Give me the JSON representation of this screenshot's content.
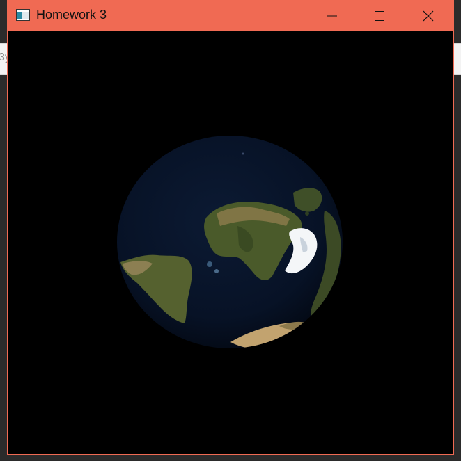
{
  "background_window": {
    "partial_text": "3y"
  },
  "window": {
    "title": "Homework 3",
    "accent": "#f06a53",
    "controls": {
      "minimize_icon": "minimize-icon",
      "maximize_icon": "maximize-icon",
      "close_icon": "close-icon"
    }
  },
  "canvas": {
    "background": "#000000",
    "content": "earth-globe"
  }
}
